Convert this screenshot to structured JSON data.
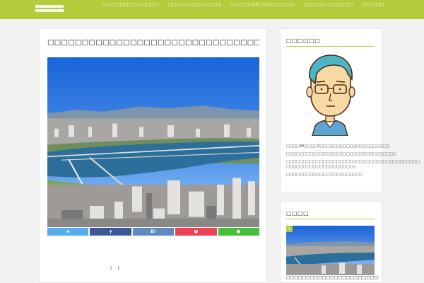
{
  "header": {
    "logo_text": "",
    "nav": [
      {
        "label": "□□□□□□□□□□□□□□□□□□□"
      },
      {
        "label": "□□□□□□□□□□□□□30"
      },
      {
        "label": "□□□□□10□□□□□□□□□□□□□"
      },
      {
        "label": "□□□□□□□□□□□□□□□□"
      },
      {
        "label": "□□□□□"
      }
    ]
  },
  "post": {
    "title": "□□□□□□□□□□□□□□□□□□□□□□□□□□□□□□□□□□□",
    "share": {
      "twitter": "",
      "facebook": "",
      "hatena": "B!",
      "pocket": "",
      "line": ""
    },
    "parenthetical": "(  )"
  },
  "profile_widget": {
    "title": "□□□□□□",
    "bio": [
      "□□□□30□□□□2□□□□□□□□□□□□□□□□□□□□□",
      "□□□□□□□□□□□□□□□□□□□□□□□□□□□□□□□□□",
      "□□□□□□□□□□□□□□□□□□□□□□□□□□□□□□□□□□□□□□□□□□□□□□□□□□□□□□□□□□□□□",
      "□□□□□□□□□□□□□□□□□□□□□□□"
    ]
  },
  "ranking_widget": {
    "title": "□□□□",
    "rank": "1",
    "caption": "□□□□□□□□□□□□□□□□□□□□□□□□□□□□"
  },
  "colors": {
    "accent": "#b3cc3c",
    "twitter": "#55acee",
    "facebook": "#3b5998",
    "hatena": "#5d8ac1",
    "pocket": "#ef4056",
    "line": "#45be3a"
  }
}
